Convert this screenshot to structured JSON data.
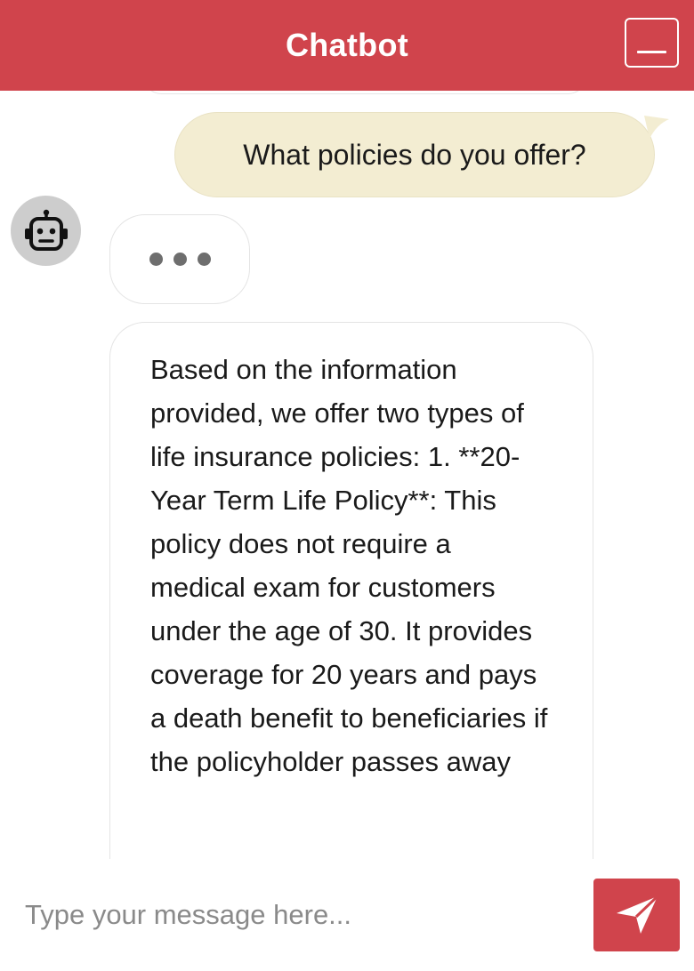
{
  "header": {
    "title": "Chatbot",
    "minimize_icon": "minimize-icon",
    "background_color": "#d0444c"
  },
  "messages": [
    {
      "role": "user",
      "text": "What policies do you offer?",
      "background_color": "#f3edd2"
    },
    {
      "role": "bot",
      "typing": true,
      "avatar_icon": "robot-icon"
    },
    {
      "role": "bot",
      "text": "Based on the information provided, we offer two types of life insurance policies: 1. **20-Year Term Life Policy**: This policy does not require a medical exam for customers under the age of 30. It provides coverage for 20 years and pays a death benefit to beneficiaries if the policyholder passes away"
    }
  ],
  "composer": {
    "placeholder": "Type your message here...",
    "value": "",
    "send_icon": "send-arrow-icon",
    "send_button_color": "#d0444c"
  }
}
